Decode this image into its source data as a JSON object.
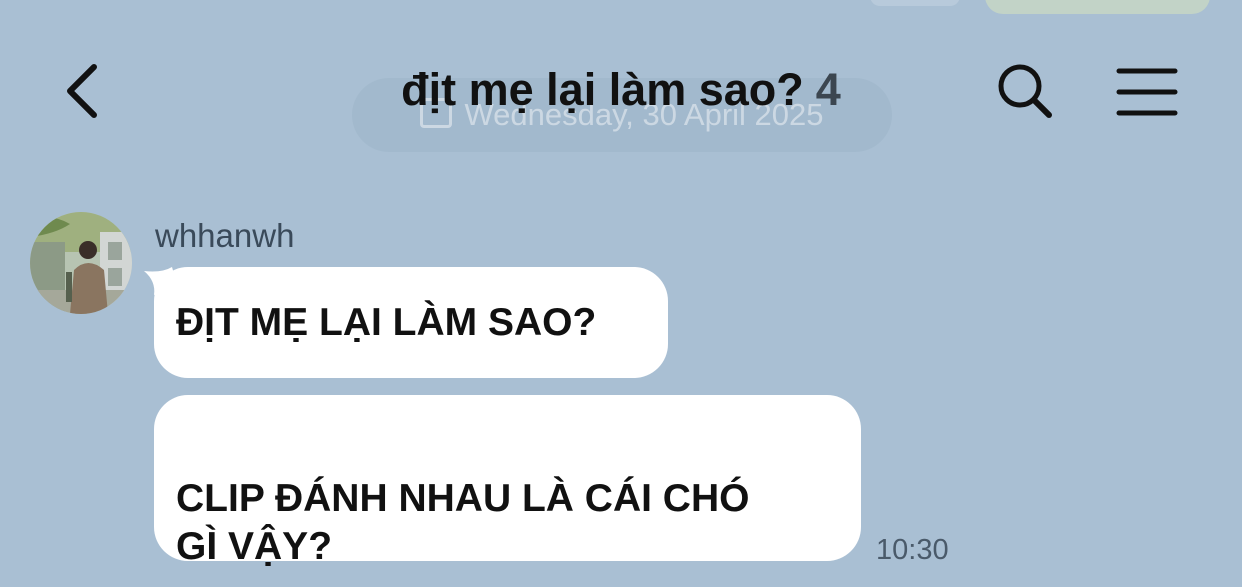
{
  "header": {
    "title": "địt mẹ lại làm sao?",
    "member_count": "4",
    "back_icon": "chevron-left-icon",
    "search_icon": "search-icon",
    "menu_icon": "hamburger-menu-icon"
  },
  "date_divider": "Wednesday, 30 April 2025",
  "messages": [
    {
      "sender": "whhanwh",
      "text": "ĐỊT MẸ LẠI LÀM SAO?"
    },
    {
      "text": "CLIP ĐÁNH NHAU LÀ CÁI CHÓ\nGÌ VẬY?",
      "time": "10:30"
    }
  ],
  "colors": {
    "background": "#a9bfd3",
    "bubble": "#ffffff",
    "text": "#111111"
  }
}
